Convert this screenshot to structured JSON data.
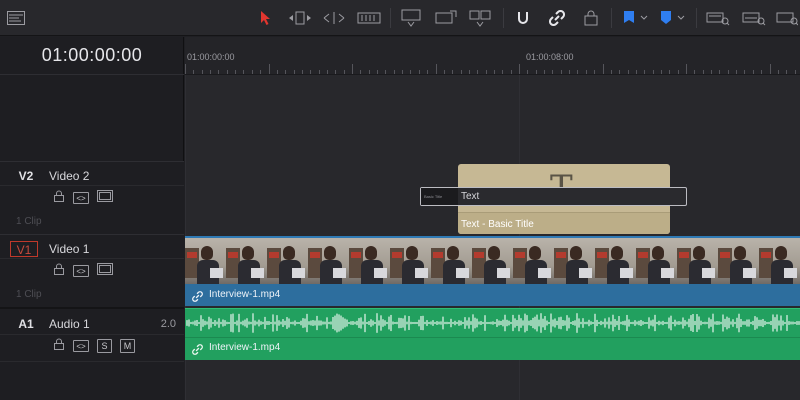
{
  "header": {
    "timecode": "01:00:00:00"
  },
  "toolbar": {
    "icons": [
      "timeline-view-icon",
      "selection-arrow-icon",
      "trim-edit-icon",
      "dynamic-trim-icon",
      "blade-edit-icon",
      "insert-clip-icon",
      "overwrite-clip-icon",
      "replace-clip-icon",
      "snapping-icon",
      "linked-selection-icon",
      "position-lock-icon",
      "flag-icon",
      "marker-icon",
      "zoom-full-icon",
      "zoom-detail-icon",
      "zoom-custom-icon"
    ],
    "accent_color": "#e2362f",
    "flag_color": "#2f7ef0"
  },
  "ruler": {
    "start_label": "01:00:00:00",
    "mid_label": "01:00:08:00"
  },
  "tracks": {
    "v2": {
      "id": "V2",
      "name": "Video 2",
      "clips": "1 Clip"
    },
    "v1": {
      "id": "V1",
      "name": "Video 1",
      "clips": "1 Clip"
    },
    "a1": {
      "id": "A1",
      "name": "Audio 1",
      "volume": "2.0",
      "solo": "S",
      "mute": "M"
    }
  },
  "clips": {
    "title": {
      "name": "Text - Basic Title",
      "glyph": "T",
      "color": "#c6b894"
    },
    "text_field": {
      "label": "Basic Title",
      "value": "Text"
    },
    "video": {
      "name": "Interview-1.mp4",
      "color": "#2d6e9e"
    },
    "audio": {
      "name": "Interview-1.mp4",
      "color": "#22a05f"
    }
  }
}
